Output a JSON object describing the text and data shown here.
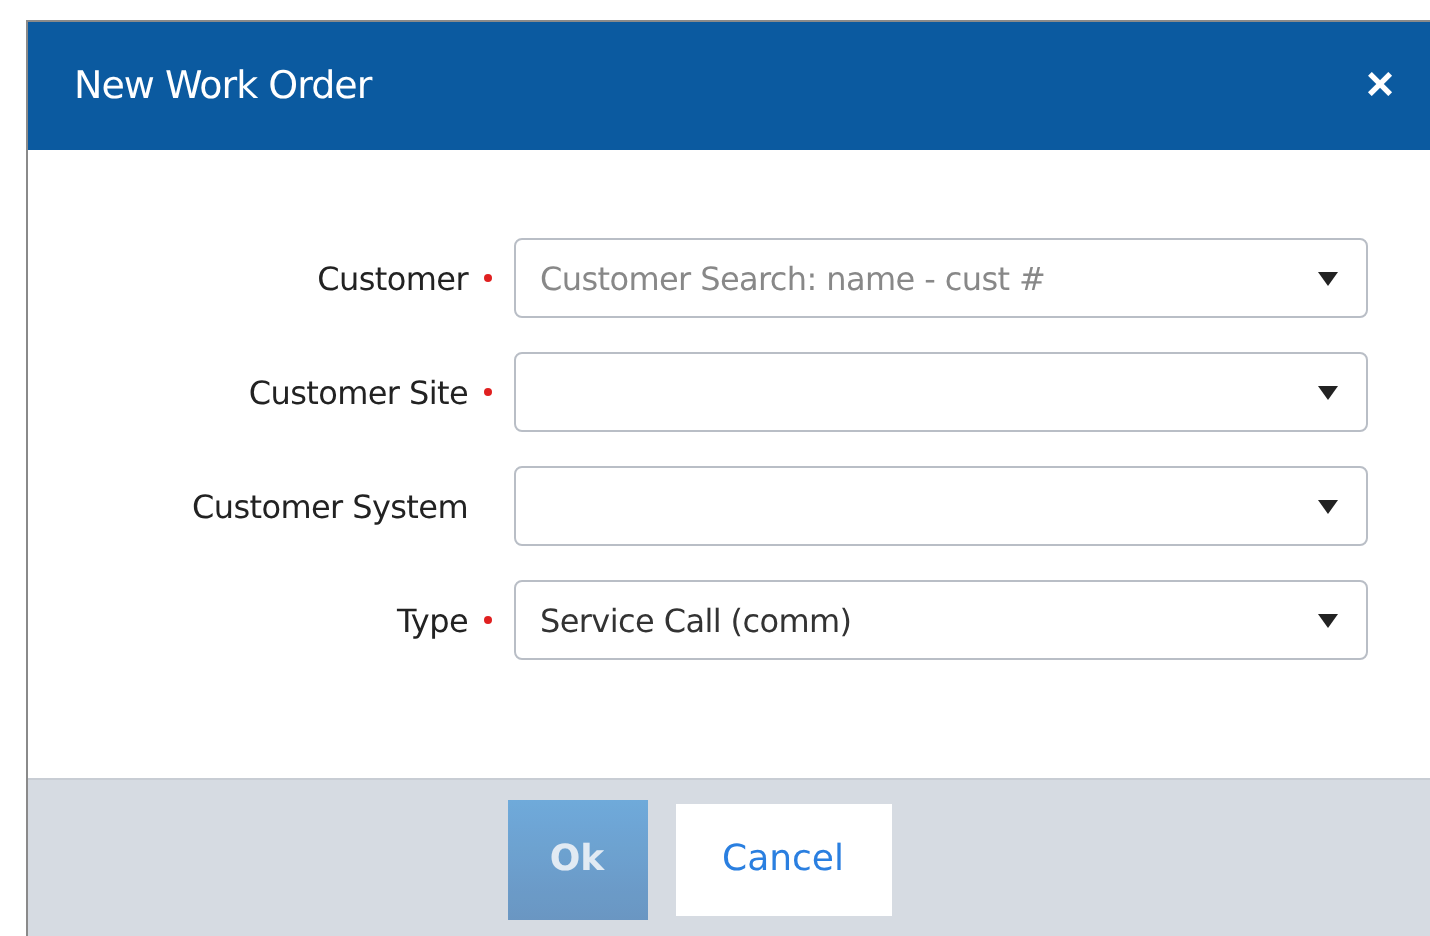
{
  "dialog": {
    "title": "New Work Order",
    "close": "×"
  },
  "fields": [
    {
      "label": "Customer",
      "required": true,
      "placeholder": "Customer Search: name - cust #"
    },
    {
      "label": "Customer Site",
      "required": true
    },
    {
      "label": "Customer System",
      "required": false
    },
    {
      "label": "Type",
      "required": true,
      "value": "Service Call (comm)"
    }
  ],
  "buttons": [
    {
      "label": "Ok",
      "kind": "primary",
      "disabled": true
    },
    {
      "label": "Cancel",
      "kind": "secondary",
      "disabled": false
    }
  ]
}
